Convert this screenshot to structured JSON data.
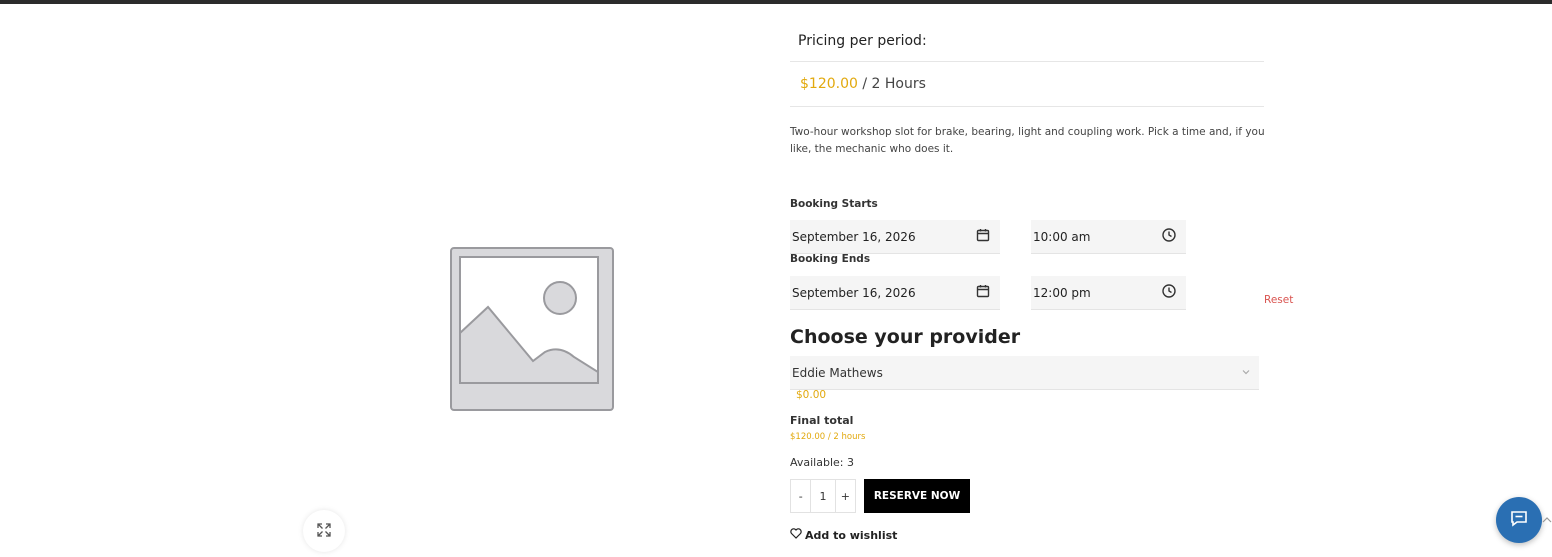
{
  "pricing": {
    "heading": "Pricing per period:",
    "amount": "$120.00",
    "period": "/ 2 Hours"
  },
  "description": "Two-hour workshop slot for brake, bearing, light and coupling work. Pick a time and, if you like, the mechanic who does it.",
  "booking": {
    "starts_label": "Booking Starts",
    "start_date": "September 16, 2026",
    "start_time": "10:00 am",
    "ends_label": "Booking Ends",
    "end_date": "September 16, 2026",
    "end_time": "12:00 pm",
    "reset_label": "Reset"
  },
  "provider": {
    "title": "Choose your provider",
    "selected": "Eddie Mathews",
    "cost": "$0.00"
  },
  "total": {
    "label": "Final total",
    "value": "$120.00 / 2 hours"
  },
  "availability": "Available: 3",
  "quantity": {
    "minus": "-",
    "value": "1",
    "plus": "+"
  },
  "reserve_label": "RESERVE NOW",
  "wishlist_label": "Add to wishlist",
  "icons": {
    "zoom": "expand-icon",
    "date": "calendar-icon",
    "time": "clock-icon",
    "select": "chevron-down-icon",
    "wishlist": "heart-icon",
    "chat": "chat-icon",
    "scroll": "chevron-up-icon"
  },
  "colors": {
    "price": "#e2a90e",
    "reset": "#d9534f",
    "button": "#000000",
    "chat": "#2a6fb3"
  }
}
